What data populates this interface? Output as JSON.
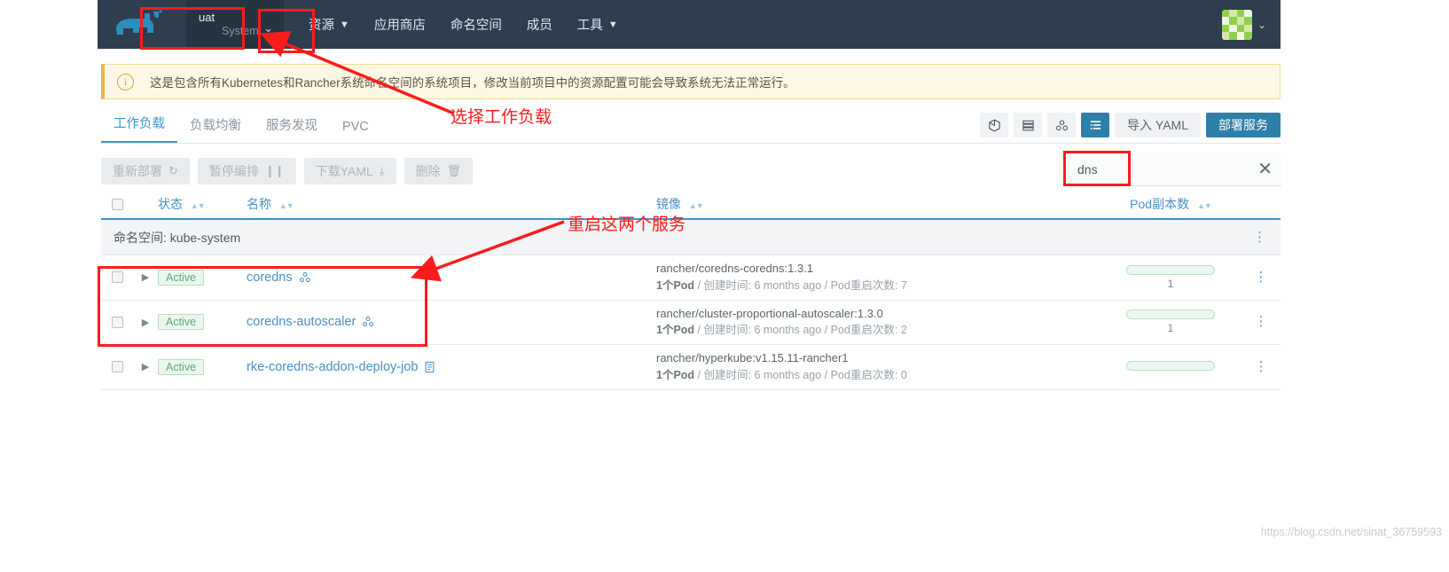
{
  "topnav": {
    "project": {
      "name": "uat",
      "scope": "System",
      "caret": "chevron-down"
    },
    "items": [
      {
        "label": "资源",
        "has_caret": true
      },
      {
        "label": "应用商店",
        "has_caret": false
      },
      {
        "label": "命名空间",
        "has_caret": false
      },
      {
        "label": "成员",
        "has_caret": false
      },
      {
        "label": "工具",
        "has_caret": true
      }
    ]
  },
  "banner": {
    "text": "这是包含所有Kubernetes和Rancher系统命名空间的系统项目，修改当前项目中的资源配置可能会导致系统无法正常运行。",
    "icon": "info-icon"
  },
  "tabs": [
    {
      "label": "工作负载",
      "active": true
    },
    {
      "label": "负载均衡",
      "active": false
    },
    {
      "label": "服务发现",
      "active": false
    },
    {
      "label": "PVC",
      "active": false
    }
  ],
  "view_toggles": [
    {
      "name": "cube-view-icon",
      "glyph": "⬡",
      "active": false
    },
    {
      "name": "stack-view-icon",
      "glyph": "▤",
      "active": false
    },
    {
      "name": "group-view-icon",
      "glyph": "⚶",
      "active": false
    },
    {
      "name": "list-view-icon",
      "glyph": "☰",
      "active": true
    }
  ],
  "header_buttons": {
    "import_yaml": "导入 YAML",
    "deploy": "部署服务"
  },
  "actions": [
    {
      "label": "重新部署",
      "glyph": "↻"
    },
    {
      "label": "暂停编排",
      "glyph": "❙❙"
    },
    {
      "label": "下载YAML",
      "glyph": "⤓"
    },
    {
      "label": "删除",
      "glyph": "🗑"
    }
  ],
  "search": {
    "value": "dns",
    "placeholder": "",
    "clear_glyph": "✕"
  },
  "table": {
    "columns": {
      "state": "状态",
      "name": "名称",
      "image": "镜像",
      "pods": "Pod副本数"
    },
    "group": {
      "label": "命名空间",
      "value": "kube-system"
    },
    "rows": [
      {
        "state": "Active",
        "name": "coredns",
        "name_icon": "workload-icon",
        "image": "rancher/coredns-coredns:1.3.1",
        "pod_count": "1个Pod",
        "created_label": "创建时间",
        "created": "6 months ago",
        "restart_label": "Pod重启次数",
        "restarts": "7",
        "scale": "1"
      },
      {
        "state": "Active",
        "name": "coredns-autoscaler",
        "name_icon": "workload-icon",
        "image": "rancher/cluster-proportional-autoscaler:1.3.0",
        "pod_count": "1个Pod",
        "created_label": "创建时间",
        "created": "6 months ago",
        "restart_label": "Pod重启次数",
        "restarts": "2",
        "scale": "1"
      },
      {
        "state": "Active",
        "name": "rke-coredns-addon-deploy-job",
        "name_icon": "job-icon",
        "image": "rancher/hyperkube:v1.15.11-rancher1",
        "pod_count": "1个Pod",
        "created_label": "创建时间",
        "created": "6 months ago",
        "restart_label": "Pod重启次数",
        "restarts": "0",
        "scale": ""
      }
    ]
  },
  "annotations": {
    "select_workload": "选择工作负载",
    "restart_two": "重启这两个服务"
  },
  "watermark": "https://blog.csdn.net/sinat_36759593",
  "colors": {
    "nav_bg": "#2e3e4e",
    "accent": "#2f7fa8",
    "link": "#4a90c2",
    "banner_bg": "#fdf8e6",
    "annotation": "#fc1b1b",
    "badge_green": "#5aab77"
  }
}
